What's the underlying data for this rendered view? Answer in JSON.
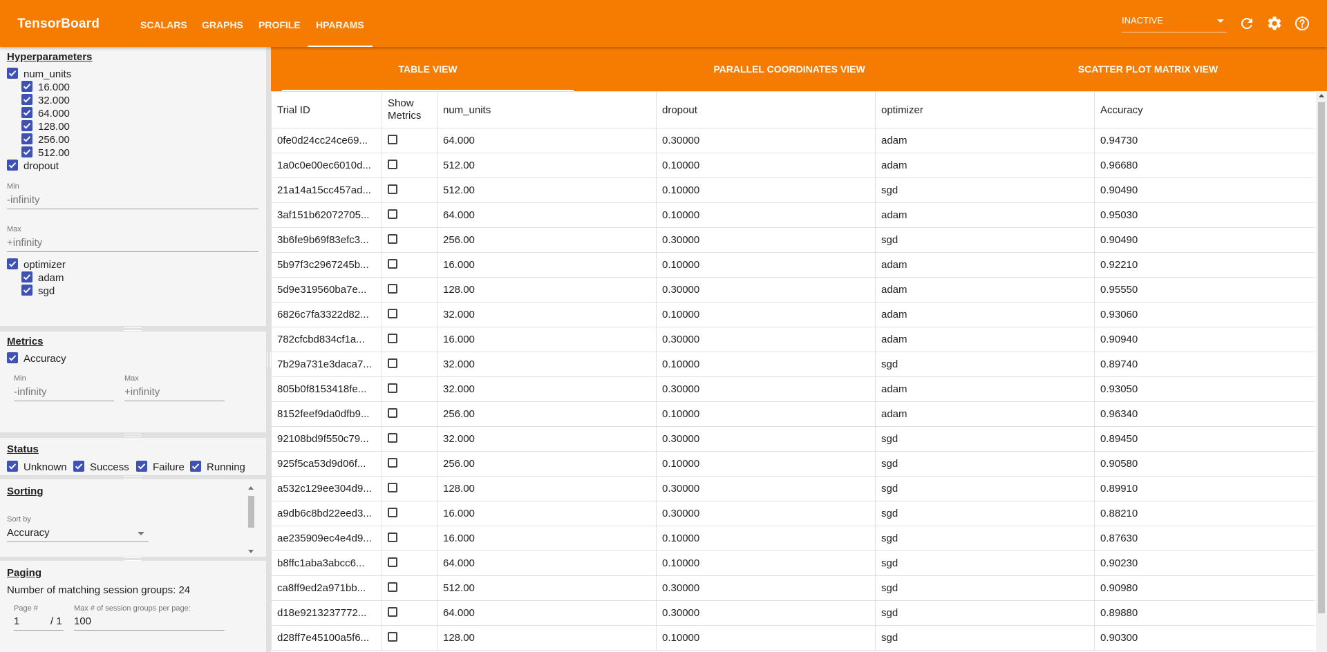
{
  "app": {
    "title": "TensorBoard",
    "nav_tabs": [
      {
        "label": "SCALARS"
      },
      {
        "label": "GRAPHS"
      },
      {
        "label": "PROFILE"
      },
      {
        "label": "HPARAMS"
      }
    ],
    "active_tab": "HPARAMS",
    "run_status": "INACTIVE",
    "accent_color": "#f57c00",
    "checkbox_color": "#3f51b5",
    "icons": [
      "refresh-icon",
      "settings-gear-icon",
      "help-icon"
    ]
  },
  "sidebar": {
    "hyperparameters": {
      "title": "Hyperparameters",
      "num_units": {
        "label": "num_units",
        "values": [
          "16.000",
          "32.000",
          "64.000",
          "128.00",
          "256.00",
          "512.00"
        ]
      },
      "dropout": {
        "label": "dropout",
        "min_label": "Min",
        "min_value": "-infinity",
        "max_label": "Max",
        "max_value": "+infinity"
      },
      "optimizer": {
        "label": "optimizer",
        "values": [
          "adam",
          "sgd"
        ]
      }
    },
    "metrics": {
      "title": "Metrics",
      "item": "Accuracy",
      "min_label": "Min",
      "min_value": "-infinity",
      "max_label": "Max",
      "max_value": "+infinity"
    },
    "status": {
      "title": "Status",
      "items": [
        "Unknown",
        "Success",
        "Failure",
        "Running"
      ]
    },
    "sorting": {
      "title": "Sorting",
      "sort_by_label": "Sort by",
      "sort_by_value": "Accuracy"
    },
    "paging": {
      "title": "Paging",
      "matching_text": "Number of matching session groups: 24",
      "page_label": "Page #",
      "page_value": "1",
      "page_total": "/ 1",
      "max_label": "Max # of session groups per page:",
      "max_value": "100"
    }
  },
  "view_tabs": [
    {
      "label": "TABLE VIEW"
    },
    {
      "label": "PARALLEL COORDINATES VIEW"
    },
    {
      "label": "SCATTER PLOT MATRIX VIEW"
    }
  ],
  "active_view": "TABLE VIEW",
  "table": {
    "headers": [
      "Trial ID",
      "Show Metrics",
      "num_units",
      "dropout",
      "optimizer",
      "Accuracy"
    ],
    "rows": [
      [
        "0fe0d24cc24ce69...",
        "64.000",
        "0.30000",
        "adam",
        "0.94730"
      ],
      [
        "1a0c0e00ec6010d...",
        "512.00",
        "0.10000",
        "adam",
        "0.96680"
      ],
      [
        "21a14a15cc457ad...",
        "512.00",
        "0.10000",
        "sgd",
        "0.90490"
      ],
      [
        "3af151b62072705...",
        "64.000",
        "0.10000",
        "adam",
        "0.95030"
      ],
      [
        "3b6fe9b69f83efc3...",
        "256.00",
        "0.30000",
        "sgd",
        "0.90490"
      ],
      [
        "5b97f3c2967245b...",
        "16.000",
        "0.10000",
        "adam",
        "0.92210"
      ],
      [
        "5d9e319560ba7e...",
        "128.00",
        "0.30000",
        "adam",
        "0.95550"
      ],
      [
        "6826c7fa3322d82...",
        "32.000",
        "0.10000",
        "adam",
        "0.93060"
      ],
      [
        "782cfcbd834cf1a...",
        "16.000",
        "0.30000",
        "adam",
        "0.90940"
      ],
      [
        "7b29a731e3daca7...",
        "32.000",
        "0.10000",
        "sgd",
        "0.89740"
      ],
      [
        "805b0f8153418fe...",
        "32.000",
        "0.30000",
        "adam",
        "0.93050"
      ],
      [
        "8152feef9da0dfb9...",
        "256.00",
        "0.10000",
        "adam",
        "0.96340"
      ],
      [
        "92108bd9f550c79...",
        "32.000",
        "0.30000",
        "sgd",
        "0.89450"
      ],
      [
        "925f5ca53d9d06f...",
        "256.00",
        "0.10000",
        "sgd",
        "0.90580"
      ],
      [
        "a532c129ee304d9...",
        "128.00",
        "0.30000",
        "sgd",
        "0.89910"
      ],
      [
        "a9db6c8bd22eed3...",
        "16.000",
        "0.30000",
        "sgd",
        "0.88210"
      ],
      [
        "ae235909ec4e4d9...",
        "16.000",
        "0.10000",
        "sgd",
        "0.87630"
      ],
      [
        "b8ffc1aba3abcc6...",
        "64.000",
        "0.10000",
        "sgd",
        "0.90230"
      ],
      [
        "ca8ff9ed2a971bb...",
        "512.00",
        "0.30000",
        "sgd",
        "0.90980"
      ],
      [
        "d18e9213237772...",
        "64.000",
        "0.30000",
        "sgd",
        "0.89880"
      ],
      [
        "d28ff7e45100a5f6...",
        "128.00",
        "0.10000",
        "sgd",
        "0.90300"
      ]
    ]
  }
}
